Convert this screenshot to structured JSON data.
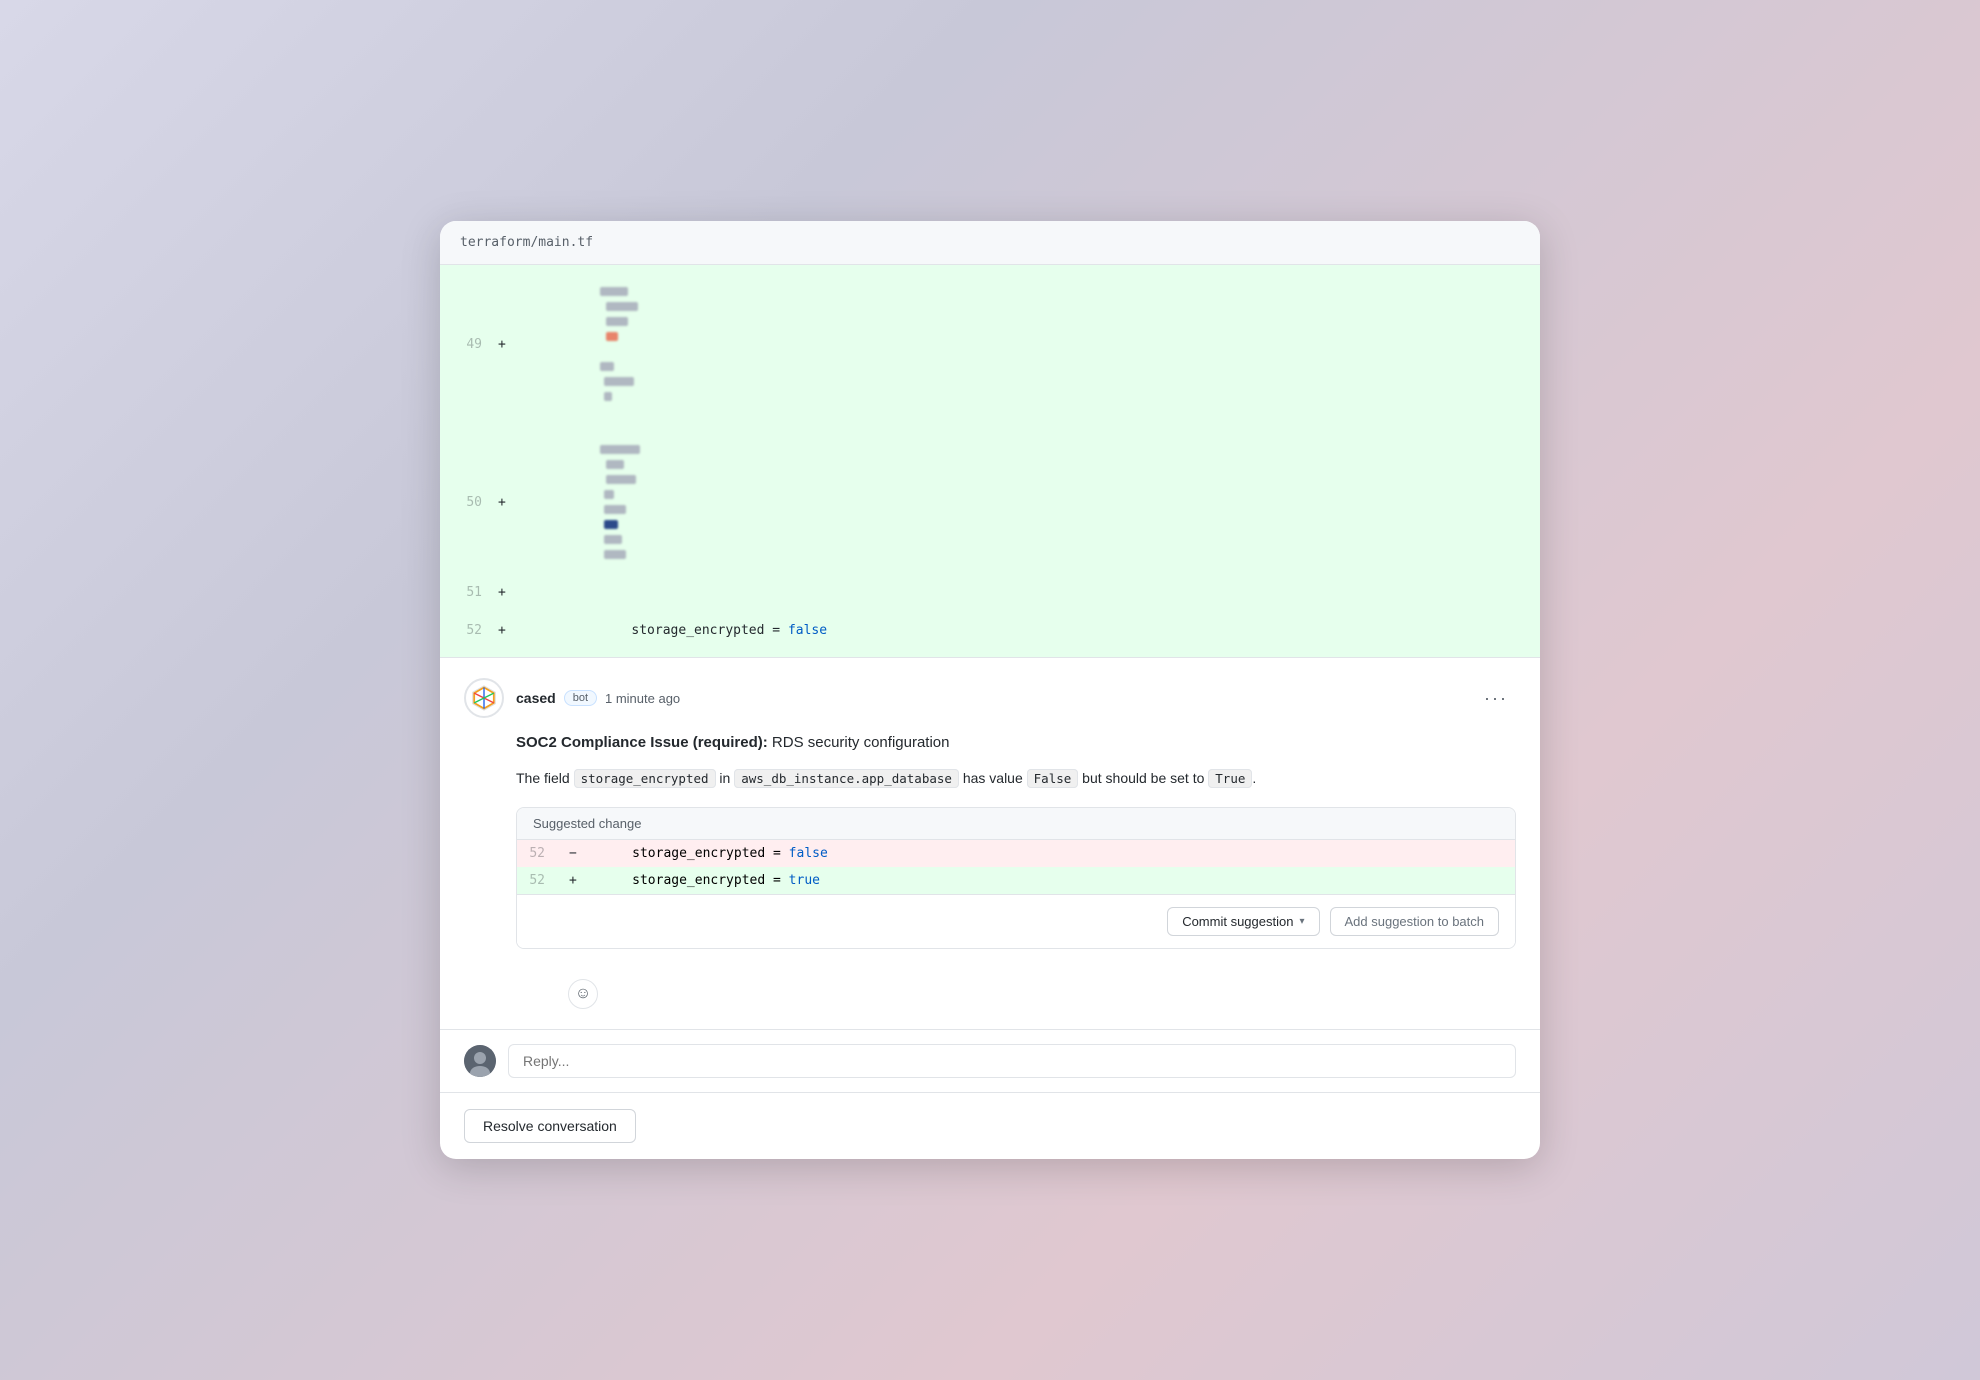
{
  "file": {
    "name": "terraform/main.tf"
  },
  "diff_lines": [
    {
      "num": "49",
      "sign": "+",
      "content_type": "blurred"
    },
    {
      "num": "50",
      "sign": "+",
      "content_type": "blurred"
    },
    {
      "num": "51",
      "sign": "+",
      "content_type": "empty"
    },
    {
      "num": "52",
      "sign": "+",
      "content_type": "code",
      "code": "storage_encrypted = false"
    }
  ],
  "comment": {
    "author": "cased",
    "bot_label": "bot",
    "timestamp": "1 minute ago",
    "title_strong": "SOC2 Compliance Issue (required):",
    "title_rest": " RDS security configuration",
    "body_prefix": "The field ",
    "field_name": "storage_encrypted",
    "body_mid1": " in ",
    "resource_name": "aws_db_instance.app_database",
    "body_mid2": " has value ",
    "current_value": "False",
    "body_mid3": " but should be set to ",
    "expected_value": "True",
    "body_suffix": ".",
    "suggested_change_label": "Suggested change",
    "suggestion": {
      "remove_line_num": "52",
      "remove_sign": "−",
      "remove_code": "storage_encrypted = false",
      "add_line_num": "52",
      "add_sign": "+",
      "add_code": "storage_encrypted = true"
    },
    "actions": {
      "commit_label": "Commit suggestion",
      "batch_label": "Add suggestion to batch"
    }
  },
  "reply": {
    "placeholder": "Reply..."
  },
  "resolve_label": "Resolve conversation",
  "more_icon": "···"
}
